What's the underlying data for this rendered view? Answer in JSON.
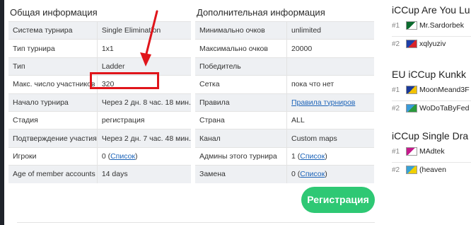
{
  "general": {
    "title": "Общая информация",
    "rows": [
      {
        "label": "Система турнира",
        "value": "Single Elimination"
      },
      {
        "label": "Тип турнира",
        "value": "1x1"
      },
      {
        "label": "Тип",
        "value": "Ladder"
      },
      {
        "label": "Макс. число участников",
        "value": "320"
      },
      {
        "label": "Начало турнира",
        "value": "Через 2 дн. 8 час. 18 мин."
      },
      {
        "label": "Стадия",
        "value": "регистрация"
      },
      {
        "label": "Подтверждение участия",
        "value": "Через 2 дн. 7 час. 48 мин."
      },
      {
        "label": "Игроки",
        "value": "0",
        "link": "Список"
      },
      {
        "label": "Age of member accounts",
        "value": "14 days"
      }
    ]
  },
  "extra": {
    "title": "Дополнительная информация",
    "rows": [
      {
        "label": "Минимально очков",
        "value": "unlimited"
      },
      {
        "label": "Максимально очков",
        "value": "20000"
      },
      {
        "label": "Победитель",
        "value": ""
      },
      {
        "label": "Сетка",
        "value": "пока что нет"
      },
      {
        "label": "Правила",
        "value": "",
        "link": "Правила турниров"
      },
      {
        "label": "Страна",
        "value": "ALL"
      },
      {
        "label": "Канал",
        "value": "Custom maps"
      },
      {
        "label": "Админы этого турнира",
        "value": "1",
        "link": "Список"
      },
      {
        "label": "Замена",
        "value": "0",
        "link": "Список"
      }
    ]
  },
  "register_button": "Регистрация",
  "sidebar": {
    "sections": [
      {
        "title": "iCCup Are You Lu",
        "items": [
          {
            "rank": "#1",
            "nick": "Mr.Sardorbek",
            "flag_colors": [
              "#0b6b2e",
              "#ffffff"
            ]
          },
          {
            "rank": "#2",
            "nick": "xqlyuziv",
            "flag_colors": [
              "#1d3fa8",
              "#d8242a"
            ]
          }
        ]
      },
      {
        "title": "EU iCCup Kunkk",
        "items": [
          {
            "rank": "#1",
            "nick": "MoonMeand3F",
            "flag_colors": [
              "#1a3a9a",
              "#f2c200"
            ]
          },
          {
            "rank": "#2",
            "nick": "WoDoTaByFed",
            "flag_colors": [
              "#3a9bd9",
              "#2a9a3c"
            ]
          }
        ]
      },
      {
        "title": "iCCup Single Dra",
        "items": [
          {
            "rank": "#1",
            "nick": "MAdtek",
            "flag_colors": [
              "#c51a8c",
              "#ffffff"
            ]
          },
          {
            "rank": "#2",
            "nick": "(heaven",
            "flag_colors": [
              "#38a3d6",
              "#f0d000"
            ]
          }
        ]
      }
    ]
  }
}
